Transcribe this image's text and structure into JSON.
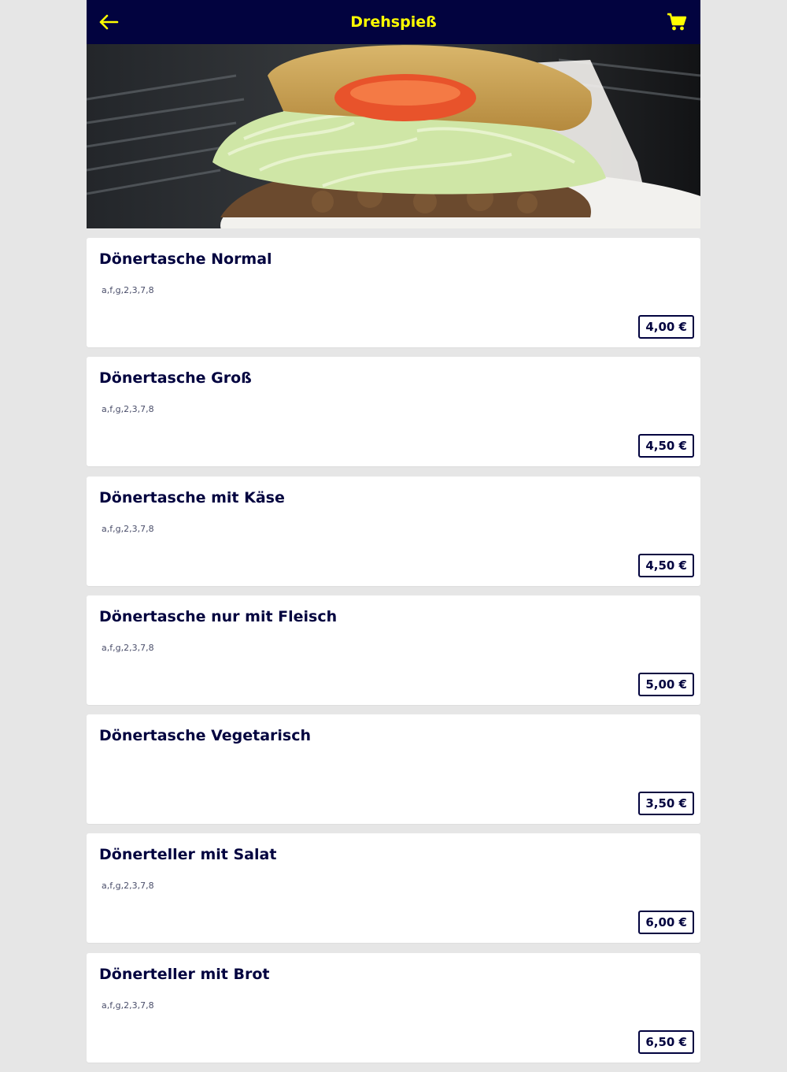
{
  "header": {
    "title": "Drehspieß",
    "back_icon": "arrow-left-icon",
    "cart_icon": "shopping-cart-icon",
    "accent_color": "#ffff00",
    "bar_color": "#02033f"
  },
  "hero": {
    "icon": "doner-kebab-photo"
  },
  "items": [
    {
      "name": "Dönertasche Normal",
      "allergens": "a,f,g,2,3,7,8",
      "price": "4,00 €"
    },
    {
      "name": "Dönertasche Groß",
      "allergens": "a,f,g,2,3,7,8",
      "price": "4,50 €"
    },
    {
      "name": "Dönertasche mit Käse",
      "allergens": "a,f,g,2,3,7,8",
      "price": "4,50 €"
    },
    {
      "name": "Dönertasche nur mit Fleisch",
      "allergens": "a,f,g,2,3,7,8",
      "price": "5,00 €"
    },
    {
      "name": "Dönertasche Vegetarisch",
      "allergens": "",
      "price": "3,50 €"
    },
    {
      "name": "Dönerteller mit Salat",
      "allergens": "a,f,g,2,3,7,8",
      "price": "6,00 €"
    },
    {
      "name": "Dönerteller mit Brot",
      "allergens": "a,f,g,2,3,7,8",
      "price": "6,50 €"
    }
  ]
}
